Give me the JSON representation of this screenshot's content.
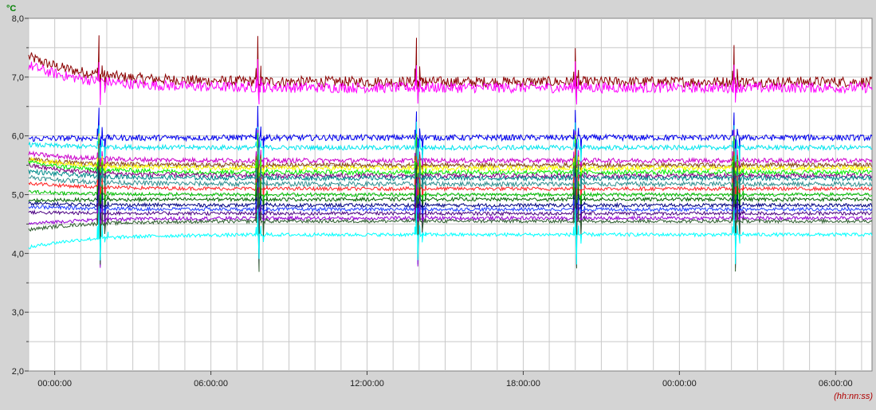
{
  "chart_data": {
    "type": "line",
    "y_unit_label": "°C",
    "x_unit_label": "(hh:nn:ss)",
    "ylim": [
      2.0,
      8.0
    ],
    "y_ticks": [
      "2,0",
      "3,0",
      "4,0",
      "5,0",
      "6,0",
      "7,0",
      "8,0"
    ],
    "y_tick_values": [
      2,
      3,
      4,
      5,
      6,
      7,
      8
    ],
    "x_ticks": [
      "00:00:00",
      "06:00:00",
      "12:00:00",
      "18:00:00",
      "00:00:00",
      "06:00:00"
    ],
    "x_tick_hours": [
      0,
      6,
      12,
      18,
      24,
      30
    ],
    "xlim_hours": [
      -1,
      31.4
    ],
    "grid": true,
    "defrost_peaks_hours": [
      1.7,
      7.8,
      13.9,
      20.0,
      26.1
    ],
    "series": [
      {
        "color": "#8b0000",
        "start": 7.35,
        "level": 6.92,
        "noise": 0.09,
        "spike_up": 0.8,
        "spike_down": 0.25
      },
      {
        "color": "#ff00ff",
        "start": 7.2,
        "level": 6.82,
        "noise": 0.09,
        "spike_up": 0.5,
        "spike_down": 0.3
      },
      {
        "color": "#0000ee",
        "start": 5.95,
        "level": 5.97,
        "noise": 0.05,
        "spike_up": 0.55,
        "spike_down": 1.0
      },
      {
        "color": "#00e5ee",
        "start": 5.85,
        "level": 5.8,
        "noise": 0.04,
        "spike_up": 0.5,
        "spike_down": 1.1
      },
      {
        "color": "#cc00cc",
        "start": 5.7,
        "level": 5.58,
        "noise": 0.04,
        "spike_up": 0.6,
        "spike_down": 1.1
      },
      {
        "color": "#8b4513",
        "start": 5.6,
        "level": 5.5,
        "noise": 0.04,
        "spike_up": 0.6,
        "spike_down": 1.1
      },
      {
        "color": "#ffff00",
        "start": 5.6,
        "level": 5.45,
        "noise": 0.04,
        "spike_up": 0.6,
        "spike_down": 1.1
      },
      {
        "color": "#00ee00",
        "start": 5.55,
        "level": 5.38,
        "noise": 0.04,
        "spike_up": 0.8,
        "spike_down": 1.2
      },
      {
        "color": "#800080",
        "start": 5.5,
        "level": 5.32,
        "noise": 0.04,
        "spike_up": 0.6,
        "spike_down": 1.1
      },
      {
        "color": "#008b8b",
        "start": 5.4,
        "level": 5.28,
        "noise": 0.04,
        "spike_up": 0.7,
        "spike_down": 1.1
      },
      {
        "color": "#2f8f8f",
        "start": 5.3,
        "level": 5.18,
        "noise": 0.04,
        "spike_up": 0.7,
        "spike_down": 1.1
      },
      {
        "color": "#ff2020",
        "start": 5.2,
        "level": 5.1,
        "noise": 0.03,
        "spike_up": 0.7,
        "spike_down": 1.1
      },
      {
        "color": "#00c000",
        "start": 5.05,
        "level": 5.0,
        "noise": 0.03,
        "spike_up": 0.7,
        "spike_down": 1.0
      },
      {
        "color": "#006400",
        "start": 4.9,
        "level": 4.92,
        "noise": 0.03,
        "spike_up": 0.7,
        "spike_down": 1.0
      },
      {
        "color": "#000080",
        "start": 4.85,
        "level": 4.82,
        "noise": 0.03,
        "spike_up": 0.6,
        "spike_down": 1.0
      },
      {
        "color": "#1e3cff",
        "start": 4.8,
        "level": 4.75,
        "noise": 0.03,
        "spike_up": 0.6,
        "spike_down": 1.0
      },
      {
        "color": "#4b0082",
        "start": 4.7,
        "level": 4.68,
        "noise": 0.03,
        "spike_up": 0.6,
        "spike_down": 1.0
      },
      {
        "color": "#9400d3",
        "start": 4.5,
        "level": 4.6,
        "noise": 0.03,
        "spike_up": 0.6,
        "spike_down": 0.9
      },
      {
        "color": "#2e5e2e",
        "start": 4.4,
        "level": 4.55,
        "noise": 0.03,
        "spike_up": 0.6,
        "spike_down": 0.9
      },
      {
        "color": "#00ffff",
        "start": 4.1,
        "level": 4.32,
        "noise": 0.03,
        "spike_up": 0.5,
        "spike_down": 0.55
      }
    ]
  },
  "colors": {
    "background": "#d4d4d4",
    "plot_background": "#ffffff",
    "grid": "#c8c8c8",
    "y_unit_label": "#008000",
    "x_unit_label": "#b00000"
  }
}
